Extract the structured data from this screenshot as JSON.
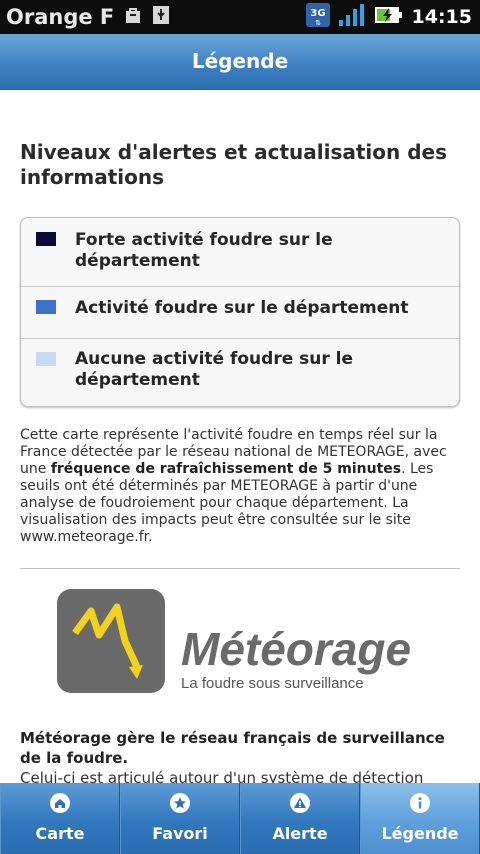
{
  "status_bar": {
    "carrier": "Orange F",
    "network": "3G",
    "time": "14:15"
  },
  "header": {
    "title": "Légende"
  },
  "section": {
    "heading": "Niveaux d'alertes et actualisation des informations"
  },
  "legend": {
    "items": [
      {
        "label": "Forte activité foudre sur le département",
        "color": "#0d0a3a"
      },
      {
        "label": "Activité foudre sur le département",
        "color": "#3c72c8"
      },
      {
        "label": "Aucune activité foudre sur le département",
        "color": "#c7daf3"
      }
    ]
  },
  "description": {
    "p1": "Cette carte représente l'activité foudre en temps réel sur la France détectée par le réseau national de METEORAGE, avec une ",
    "p1_bold": "fréquence de rafraîchissement de 5 minutes",
    "p2": ". Les seuils ont été déterminés par METEORAGE à partir d'une analyse de foudroiement pour chaque département. La visualisation des impacts peut être consultée sur le site www.meteorage.fr."
  },
  "logo": {
    "name": "Météorage",
    "tagline": "La foudre sous surveillance"
  },
  "about": {
    "bold": "Météorage gère le réseau français de surveillance de la foudre.",
    "cut_text": "Celui-ci est articulé autour d'un système de détection"
  },
  "tabs": [
    {
      "label": "Carte",
      "icon": "home-icon",
      "active": false
    },
    {
      "label": "Favori",
      "icon": "star-icon",
      "active": false
    },
    {
      "label": "Alerte",
      "icon": "warning-icon",
      "active": false
    },
    {
      "label": "Légende",
      "icon": "info-icon",
      "active": true
    }
  ]
}
